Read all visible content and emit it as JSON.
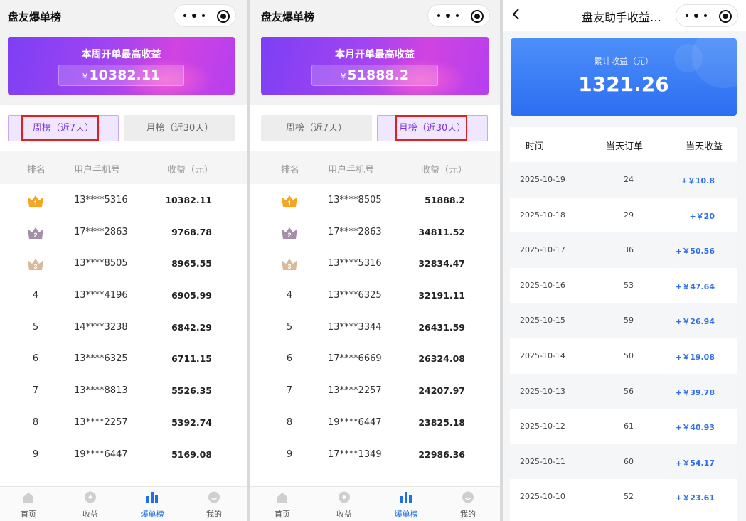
{
  "screen1": {
    "app_title": "盘友爆单榜",
    "banner_title": "本周开单最高收益",
    "banner_currency": "¥",
    "banner_value": "10382.11",
    "tab_weekly": "周榜（近7天）",
    "tab_monthly": "月榜（近30天）",
    "active_tab": "weekly",
    "columns": {
      "rank": "排名",
      "phone": "用户手机号",
      "earnings": "收益（元）"
    },
    "rows": [
      {
        "rank": "1",
        "phone": "13****5316",
        "earnings": "10382.11"
      },
      {
        "rank": "2",
        "phone": "17****2863",
        "earnings": "9768.78"
      },
      {
        "rank": "3",
        "phone": "13****8505",
        "earnings": "8965.55"
      },
      {
        "rank": "4",
        "phone": "13****4196",
        "earnings": "6905.99"
      },
      {
        "rank": "5",
        "phone": "14****3238",
        "earnings": "6842.29"
      },
      {
        "rank": "6",
        "phone": "13****6325",
        "earnings": "6711.15"
      },
      {
        "rank": "7",
        "phone": "13****8813",
        "earnings": "5526.35"
      },
      {
        "rank": "8",
        "phone": "13****2257",
        "earnings": "5392.74"
      },
      {
        "rank": "9",
        "phone": "19****6447",
        "earnings": "5169.08"
      }
    ]
  },
  "screen2": {
    "app_title": "盘友爆单榜",
    "banner_title": "本月开单最高收益",
    "banner_currency": "¥",
    "banner_value": "51888.2",
    "tab_weekly": "周榜（近7天）",
    "tab_monthly": "月榜（近30天）",
    "active_tab": "monthly",
    "columns": {
      "rank": "排名",
      "phone": "用户手机号",
      "earnings": "收益（元）"
    },
    "rows": [
      {
        "rank": "1",
        "phone": "13****8505",
        "earnings": "51888.2"
      },
      {
        "rank": "2",
        "phone": "17****2863",
        "earnings": "34811.52"
      },
      {
        "rank": "3",
        "phone": "13****5316",
        "earnings": "32834.47"
      },
      {
        "rank": "4",
        "phone": "13****6325",
        "earnings": "32191.11"
      },
      {
        "rank": "5",
        "phone": "13****3344",
        "earnings": "26431.59"
      },
      {
        "rank": "6",
        "phone": "17****6669",
        "earnings": "26324.08"
      },
      {
        "rank": "7",
        "phone": "13****2257",
        "earnings": "24207.97"
      },
      {
        "rank": "8",
        "phone": "19****6447",
        "earnings": "23825.18"
      },
      {
        "rank": "9",
        "phone": "17****1349",
        "earnings": "22986.36"
      }
    ]
  },
  "tabbar": {
    "items": [
      {
        "label": "首页",
        "icon": "home-icon"
      },
      {
        "label": "收益",
        "icon": "earnings-icon"
      },
      {
        "label": "爆单榜",
        "icon": "leaderboard-icon"
      },
      {
        "label": "我的",
        "icon": "profile-icon"
      }
    ],
    "active": "爆单榜"
  },
  "screen3": {
    "title": "盘友助手收益…",
    "card_label": "累计收益（元）",
    "card_value": "1321.26",
    "columns": {
      "date": "时间",
      "orders": "当天订单",
      "earnings": "当天收益"
    },
    "rows": [
      {
        "date": "2025-10-19",
        "orders": "24",
        "earnings": "+￥10.8"
      },
      {
        "date": "2025-10-18",
        "orders": "29",
        "earnings": "+￥20"
      },
      {
        "date": "2025-10-17",
        "orders": "36",
        "earnings": "+￥50.56"
      },
      {
        "date": "2025-10-16",
        "orders": "53",
        "earnings": "+￥47.64"
      },
      {
        "date": "2025-10-15",
        "orders": "59",
        "earnings": "+￥26.94"
      },
      {
        "date": "2025-10-14",
        "orders": "50",
        "earnings": "+￥19.08"
      },
      {
        "date": "2025-10-13",
        "orders": "56",
        "earnings": "+￥39.78"
      },
      {
        "date": "2025-10-12",
        "orders": "61",
        "earnings": "+￥40.93"
      },
      {
        "date": "2025-10-11",
        "orders": "60",
        "earnings": "+￥54.17"
      },
      {
        "date": "2025-10-10",
        "orders": "52",
        "earnings": "+￥23.61"
      }
    ]
  },
  "colors": {
    "accent_purple": "#7a36d9",
    "highlight_red": "#e0201f",
    "accent_blue": "#2f6ee8",
    "crown_gold": "#f5a623",
    "crown_silver": "#a58ea8",
    "crown_bronze": "#d9b99a"
  }
}
